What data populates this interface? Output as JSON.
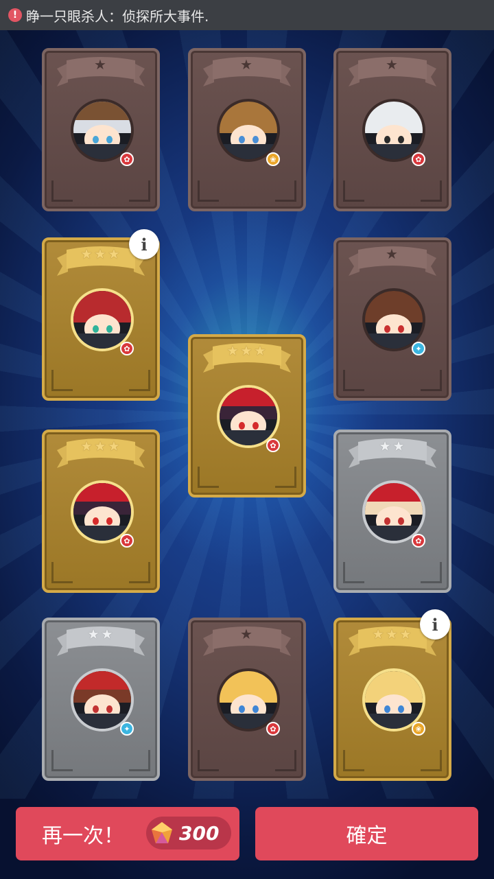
{
  "notification": {
    "icon": "alert-icon",
    "text": "睁一只眼杀人：侦探所大事件."
  },
  "cards": [
    {
      "id": "c1",
      "rarity": "bronze",
      "stars": 1,
      "element": "rabbit",
      "hair": "#d9dde4",
      "cap": "#7a5233",
      "eyes": "#49a6d8"
    },
    {
      "id": "c2",
      "rarity": "bronze",
      "stars": 1,
      "element": "paw",
      "hair": "#a9763b",
      "cap": "",
      "eyes": "#4a8fd6"
    },
    {
      "id": "c3",
      "rarity": "bronze",
      "stars": 1,
      "element": "rabbit",
      "hair": "#e9ecef",
      "cap": "",
      "eyes": "#2b2b2b"
    },
    {
      "id": "c4",
      "rarity": "gold",
      "stars": 3,
      "element": "rabbit",
      "hair": "#b82b2e",
      "cap": "",
      "eyes": "#2fb39a",
      "info": true
    },
    {
      "id": "c5",
      "rarity": "bronze",
      "stars": 1,
      "element": "bird",
      "hair": "#6e3e2a",
      "cap": "",
      "eyes": "#c93030"
    },
    {
      "id": "c6",
      "rarity": "gold",
      "stars": 3,
      "element": "rabbit",
      "hair": "#3a2438",
      "cap": "#c7202c",
      "eyes": "#d52b2b"
    },
    {
      "id": "c7",
      "rarity": "gold",
      "stars": 3,
      "element": "rabbit",
      "hair": "#3a2438",
      "cap": "#c7202c",
      "eyes": "#d52b2b"
    },
    {
      "id": "c8",
      "rarity": "silver",
      "stars": 2,
      "element": "rabbit",
      "hair": "#f0d9b8",
      "cap": "#c7202c",
      "eyes": "#c23232"
    },
    {
      "id": "c9",
      "rarity": "silver",
      "stars": 2,
      "element": "bird",
      "hair": "#7a3a28",
      "cap": "#c22a2a",
      "eyes": "#c23232"
    },
    {
      "id": "c10",
      "rarity": "bronze",
      "stars": 1,
      "element": "rabbit",
      "hair": "#f2c258",
      "cap": "",
      "eyes": "#3f86d6"
    },
    {
      "id": "c11",
      "rarity": "gold",
      "stars": 3,
      "element": "paw",
      "hair": "#f3d27a",
      "cap": "",
      "eyes": "#3f86d6",
      "info": true
    }
  ],
  "buttons": {
    "retry_label": "再一次！",
    "retry_cost": "300",
    "retry_cost_icon": "gem-icon",
    "confirm_label": "確定"
  },
  "colors": {
    "button": "#e0495b",
    "gold_card": "#b18b3a",
    "silver_card": "#8c8f93",
    "bronze_card": "#6b5350"
  }
}
